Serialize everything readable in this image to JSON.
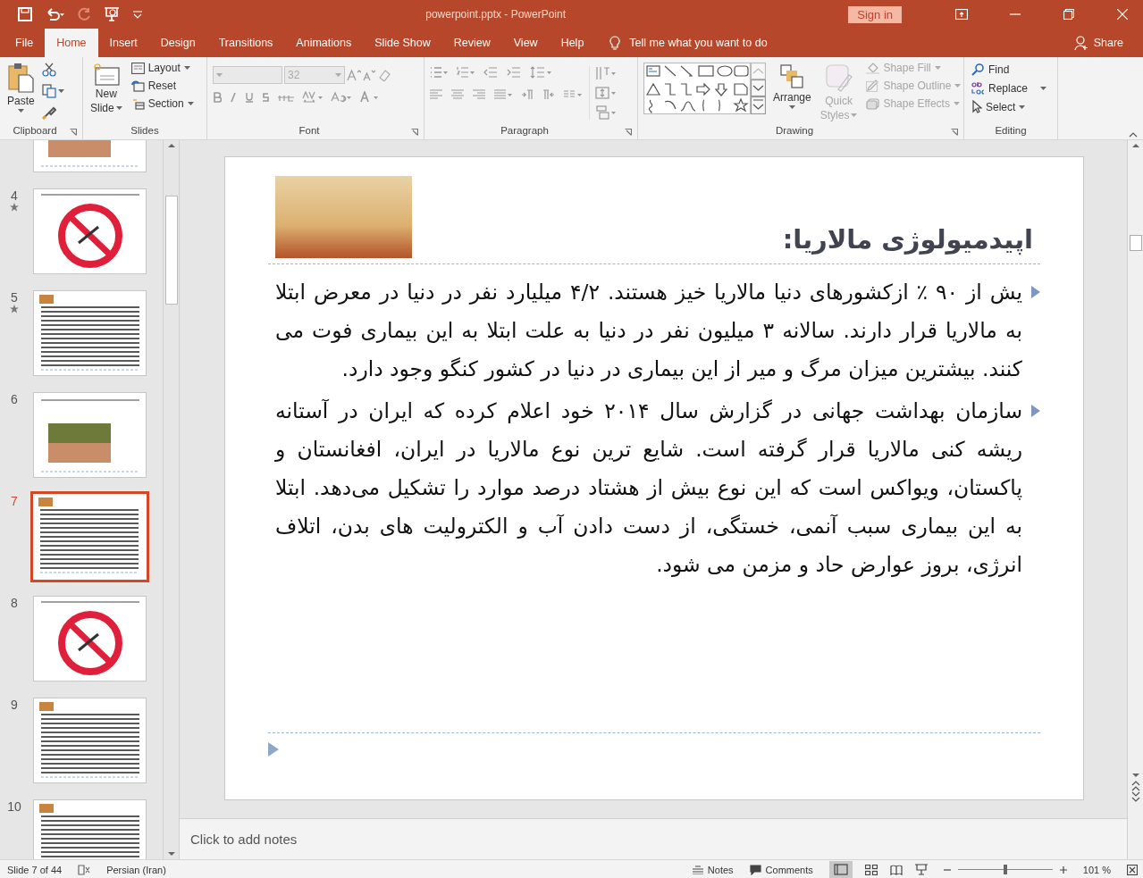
{
  "title_bar": {
    "document_title": "powerpoint.pptx  -  PowerPoint",
    "sign_in": "Sign in"
  },
  "tabs": [
    {
      "label": "File",
      "selected": false
    },
    {
      "label": "Home",
      "selected": true
    },
    {
      "label": "Insert",
      "selected": false
    },
    {
      "label": "Design",
      "selected": false
    },
    {
      "label": "Transitions",
      "selected": false
    },
    {
      "label": "Animations",
      "selected": false
    },
    {
      "label": "Slide Show",
      "selected": false
    },
    {
      "label": "Review",
      "selected": false
    },
    {
      "label": "View",
      "selected": false
    },
    {
      "label": "Help",
      "selected": false
    }
  ],
  "tell_me": "Tell me what you want to do",
  "share": "Share",
  "ribbon": {
    "clipboard": {
      "label": "Clipboard",
      "paste": "Paste"
    },
    "slides": {
      "label": "Slides",
      "new_slide": [
        "New",
        "Slide"
      ],
      "layout": "Layout",
      "reset": "Reset",
      "section": "Section"
    },
    "font": {
      "label": "Font",
      "size": "32",
      "disabled": true
    },
    "paragraph": {
      "label": "Paragraph"
    },
    "drawing": {
      "label": "Drawing",
      "arrange": "Arrange",
      "quick_styles": {
        "label": [
          "Quick",
          "Styles"
        ],
        "disabled": true
      },
      "shape_commands": [
        {
          "label": "Shape Fill",
          "disabled": true
        },
        {
          "label": "Shape Outline",
          "disabled": true
        },
        {
          "label": "Shape Effects",
          "disabled": true
        }
      ]
    },
    "editing": {
      "label": "Editing",
      "find": "Find",
      "replace": "Replace",
      "select": "Select"
    }
  },
  "thumbnails": [
    {
      "kind": "photo",
      "selected": false
    },
    {
      "number": "4",
      "kind": "sign",
      "starred": true,
      "selected": false
    },
    {
      "number": "5",
      "kind": "text",
      "starred": true,
      "selected": false
    },
    {
      "number": "6",
      "kind": "photo",
      "starred": false,
      "selected": false
    },
    {
      "number": "7",
      "kind": "text",
      "starred": false,
      "selected": true
    },
    {
      "number": "8",
      "kind": "sign",
      "starred": false,
      "selected": false
    },
    {
      "number": "9",
      "kind": "text",
      "starred": false,
      "selected": false
    },
    {
      "number": "10",
      "kind": "text",
      "starred": false,
      "selected": false
    }
  ],
  "slide": {
    "title": "اپیدمیولوژی مالاریا:",
    "bullets": [
      "یش از ۹۰ ٪ ازکشورهای دنیا مالاریا خیز هستند. ۴/۲ میلیارد نفر در دنیا در معرض ابتلا به مالاریا قرار دارند. سالانه ۳ میلیون نفر در دنیا به علت ابتلا به این بیماری فوت می کنند. بیشترین میزان مرگ و میر از این بیماری در دنیا در کشور کنگو وجود دارد.",
      "سازمان بهداشت جهانی در گزارش سال ۲۰۱۴ خود اعلام کرده که ایران در آستانه ریشه کنی مالاریا قرار گرفته است. شایع ترین نوع مالاریا در ایران، افغانستان و پاکستان، ویواکس است که این نوع بیش از هشتاد درصد موارد را تشکیل می‌دهد. ابتلا به این بیماری سبب آنمی، خستگی، از دست دادن آب و الکترولیت های بدن، اتلاف انرژی، بروز عوارض حاد و مزمن می شود."
    ]
  },
  "notes_placeholder": "Click to add notes",
  "status_bar": {
    "slide_position": "Slide 7 of 44",
    "language": "Persian (Iran)",
    "notes": "Notes",
    "comments": "Comments",
    "zoom": {
      "level": 0.5,
      "reading": "101 %"
    }
  }
}
